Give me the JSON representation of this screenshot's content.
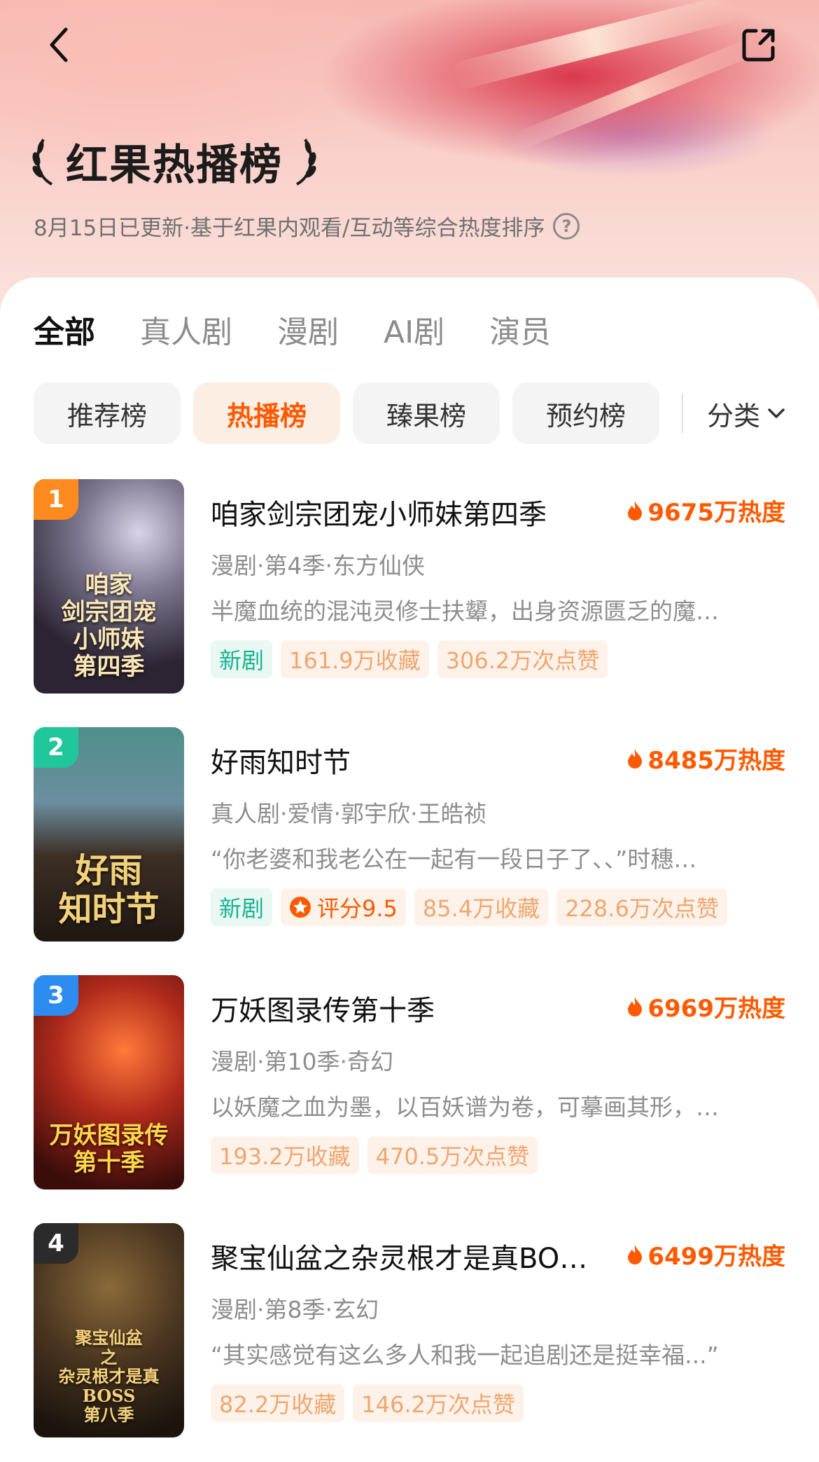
{
  "header": {
    "title": "红果热播榜",
    "subtitle": "8月15日已更新·基于红果内观看/互动等综合热度排序",
    "help_glyph": "?"
  },
  "tabs": [
    {
      "label": "全部",
      "active": true
    },
    {
      "label": "真人剧",
      "active": false
    },
    {
      "label": "漫剧",
      "active": false
    },
    {
      "label": "AI剧",
      "active": false
    },
    {
      "label": "演员",
      "active": false
    }
  ],
  "chips": [
    {
      "label": "推荐榜",
      "active": false
    },
    {
      "label": "热播榜",
      "active": true
    },
    {
      "label": "臻果榜",
      "active": false
    },
    {
      "label": "预约榜",
      "active": false
    }
  ],
  "filter": {
    "label": "分类"
  },
  "colors": {
    "accent": "#ff5a00",
    "new_tag": "#18b290",
    "rank1": "#ff8a1f",
    "rank2": "#1fc79b",
    "rank3": "#2d8cf0",
    "rank4": "#2b2b2b"
  },
  "items": [
    {
      "rank": "1",
      "name": "咱家剑宗团宠小师妹第四季",
      "heat": "9675万热度",
      "meta": "漫剧·第4季·东方仙侠",
      "desc": "半魔血统的混沌灵修士扶顰，出身资源匮乏的魔…",
      "tag_new": "新剧",
      "tag_score": "",
      "tag_fav": "161.9万收藏",
      "tag_like": "306.2万次点赞",
      "cover_text": "咱家\n剑宗团宠\n小师妹\n第四季"
    },
    {
      "rank": "2",
      "name": "好雨知时节",
      "heat": "8485万热度",
      "meta": "真人剧·爱情·郭宇欣·王皓祯",
      "desc": "“你老婆和我老公在一起有一段日子了、、”时穗…",
      "tag_new": "新剧",
      "tag_score": "评分9.5",
      "tag_fav": "85.4万收藏",
      "tag_like": "228.6万次点赞",
      "cover_text": "好雨\n知时节"
    },
    {
      "rank": "3",
      "name": "万妖图录传第十季",
      "heat": "6969万热度",
      "meta": "漫剧·第10季·奇幻",
      "desc": "以妖魔之血为墨，以百妖谱为卷，可摹画其形，…",
      "tag_new": "",
      "tag_score": "",
      "tag_fav": "193.2万收藏",
      "tag_like": "470.5万次点赞",
      "cover_text": "万妖图录传\n第十季"
    },
    {
      "rank": "4",
      "name": "聚宝仙盆之杂灵根才是真BO…",
      "heat": "6499万热度",
      "meta": "漫剧·第8季·玄幻",
      "desc": "“其实感觉有这么多人和我一起追剧还是挺幸福...”",
      "tag_new": "",
      "tag_score": "",
      "tag_fav": "82.2万收藏",
      "tag_like": "146.2万次点赞",
      "cover_text": "聚宝仙盆\n之\n杂灵根才是真BOSS\n第八季"
    }
  ]
}
